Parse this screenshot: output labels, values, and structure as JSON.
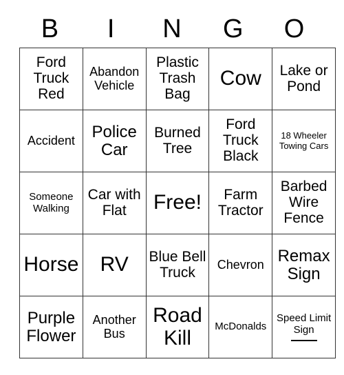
{
  "card": {
    "title_letters": [
      "B",
      "I",
      "N",
      "G",
      "O"
    ],
    "columns": 5,
    "rows": 5,
    "grid": [
      [
        {
          "text": "Ford Truck Red",
          "size": "lg"
        },
        {
          "text": "Abandon Vehicle",
          "size": "md"
        },
        {
          "text": "Plastic Trash Bag",
          "size": "lg"
        },
        {
          "text": "Cow",
          "size": "xxl"
        },
        {
          "text": "Lake or Pond",
          "size": "lg"
        }
      ],
      [
        {
          "text": "Accident",
          "size": "md"
        },
        {
          "text": "Police Car",
          "size": "xl"
        },
        {
          "text": "Burned Tree",
          "size": "lg"
        },
        {
          "text": "Ford Truck Black",
          "size": "lg"
        },
        {
          "text": "18 Wheeler Towing Cars",
          "size": "xs"
        }
      ],
      [
        {
          "text": "Someone Walking",
          "size": "sm"
        },
        {
          "text": "Car with Flat",
          "size": "lg"
        },
        {
          "text": "Free!",
          "size": "xxl"
        },
        {
          "text": "Farm Tractor",
          "size": "lg"
        },
        {
          "text": "Barbed Wire Fence",
          "size": "lg"
        }
      ],
      [
        {
          "text": "Horse",
          "size": "xxl"
        },
        {
          "text": "RV",
          "size": "xxl"
        },
        {
          "text": "Blue Bell Truck",
          "size": "lg"
        },
        {
          "text": "Chevron",
          "size": "md"
        },
        {
          "text": "Remax Sign",
          "size": "xl"
        }
      ],
      [
        {
          "text": "Purple Flower",
          "size": "xl"
        },
        {
          "text": "Another Bus",
          "size": "md"
        },
        {
          "text": "Road Kill",
          "size": "xxl"
        },
        {
          "text": "McDonalds",
          "size": "sm"
        },
        {
          "text": "Speed Limit Sign",
          "size": "sm",
          "blank_line": true
        }
      ]
    ]
  }
}
